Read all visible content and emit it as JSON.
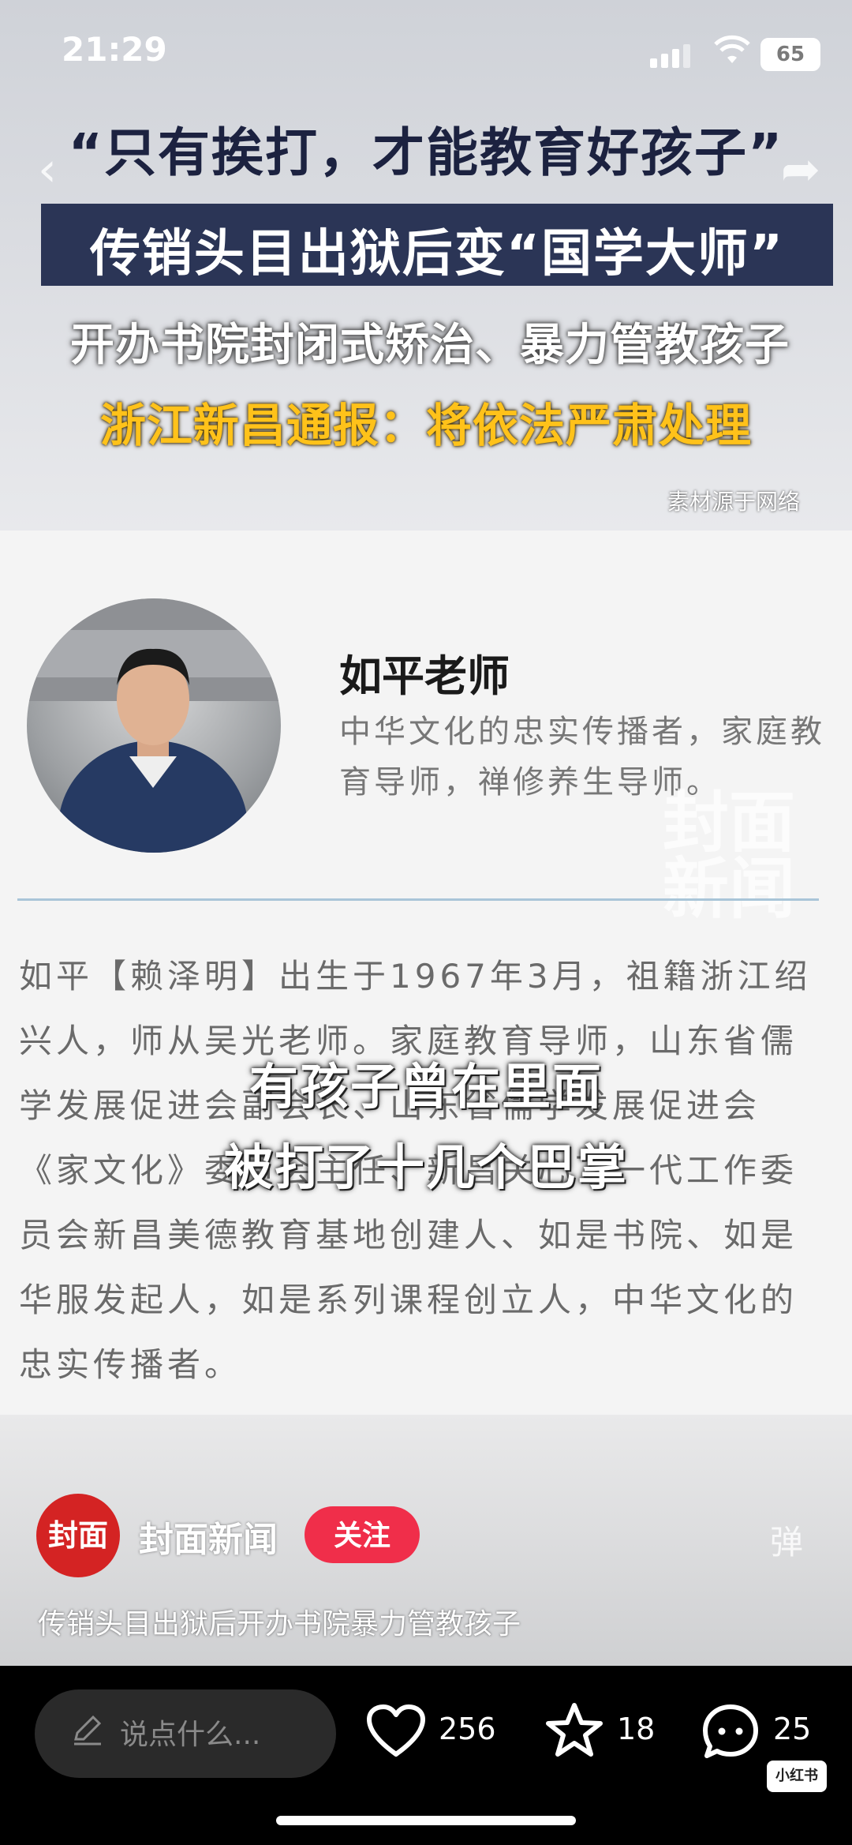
{
  "status_bar": {
    "time": "21:29",
    "battery": "65"
  },
  "headline": {
    "line1": "“只有挨打，才能教育好孩子”",
    "line2": "传销头目出狱后变“国学大师”",
    "line3": "开办书院封闭式矫治、暴力管教孩子",
    "line4": "浙江新昌通报：将依法严肃处理",
    "source_note": "素材源于网络"
  },
  "profile": {
    "name": "如平老师",
    "intro": "中华文化的忠实传播者，家庭教育导师，禅修养生导师。",
    "bio": "如平【赖泽明】出生于1967年3月，祖籍浙江绍兴人，师从吴光老师。家庭教育导师，山东省儒学发展促进会副会长、山东省儒学发展促进会《家文化》委员会主任、新昌关心下一代工作委员会新昌美德教育基地创建人、如是书院、如是华服发起人，如是系列课程创立人，中华文化的忠实传播者。",
    "watermark": "封面新闻"
  },
  "subtitles": {
    "line1": "有孩子曾在里面",
    "line2": "被打了十几个巴掌"
  },
  "author": {
    "logo_text": "封面",
    "name": "封面新闻",
    "follow_label": "关注",
    "danmu_label": "弹"
  },
  "caption": "传销头目出狱后开办书院暴力管教孩子",
  "bottom_bar": {
    "comment_placeholder": "说点什么...",
    "likes": "256",
    "favorites": "18",
    "comments": "25",
    "app_badge": "小红书"
  }
}
